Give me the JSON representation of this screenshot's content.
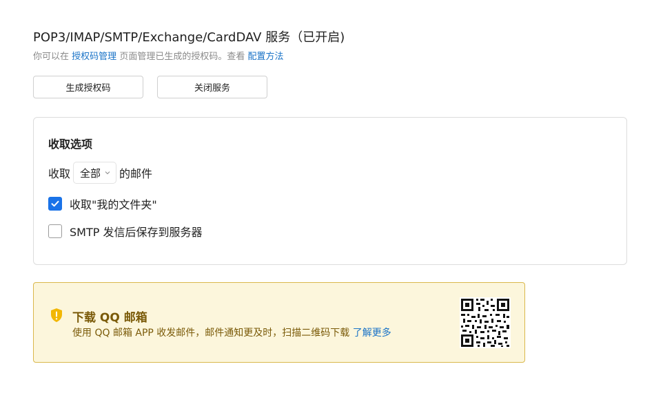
{
  "header": {
    "title": "POP3/IMAP/SMTP/Exchange/CardDAV 服务（已开启)",
    "desc_prefix": "你可以在",
    "link_auth_manage": "授权码管理",
    "desc_middle": "页面管理已生成的授权码。查看",
    "link_config": "配置方法"
  },
  "actions": {
    "generate_label": "生成授权码",
    "close_label": "关闭服务"
  },
  "options": {
    "title": "收取选项",
    "receive_prefix": "收取",
    "receive_select_value": "全部",
    "receive_suffix": "的邮件",
    "checkbox_my_folders": {
      "label": "收取\"我的文件夹\"",
      "checked": true
    },
    "checkbox_smtp_save": {
      "label": "SMTP 发信后保存到服务器",
      "checked": false
    }
  },
  "banner": {
    "title": "下载 QQ 邮箱",
    "desc": "使用 QQ 邮箱 APP 收发邮件，邮件通知更及时，扫描二维码下载",
    "link": "了解更多",
    "icon": "shield-icon",
    "qr_icon": "qr-code-icon"
  },
  "colors": {
    "link": "#1a73c7",
    "checkbox_on": "#1a73e8",
    "banner_bg": "#fcf6dc",
    "banner_border": "#d9b74b",
    "banner_text": "#7a5a08"
  }
}
